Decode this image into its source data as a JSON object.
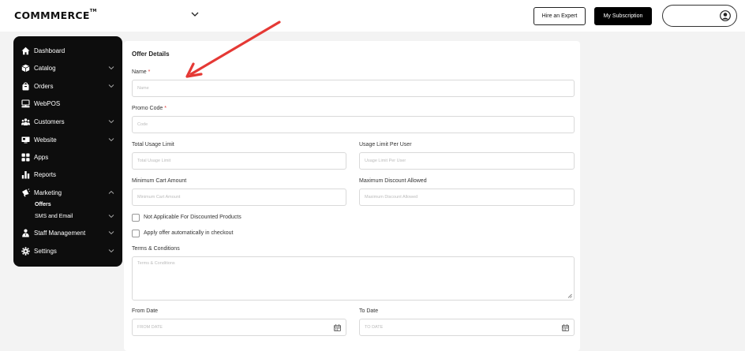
{
  "brand": {
    "logo_text": "COMMMERCE",
    "trademark": "TM"
  },
  "header": {
    "hire_label": "Hire an Expert",
    "subscription_label": "My Subscription"
  },
  "sidebar": {
    "items": [
      {
        "label": "Dashboard",
        "icon": "home-icon",
        "has_chevron": false
      },
      {
        "label": "Catalog",
        "icon": "box-icon",
        "has_chevron": true
      },
      {
        "label": "Orders",
        "icon": "bag-icon",
        "has_chevron": true
      },
      {
        "label": "WebPOS",
        "icon": "pos-icon",
        "has_chevron": false
      },
      {
        "label": "Customers",
        "icon": "users-icon",
        "has_chevron": true
      },
      {
        "label": "Website",
        "icon": "website-icon",
        "has_chevron": true
      },
      {
        "label": "Apps",
        "icon": "apps-icon",
        "has_chevron": false
      },
      {
        "label": "Reports",
        "icon": "chart-icon",
        "has_chevron": false
      },
      {
        "label": "Marketing",
        "icon": "megaphone-icon",
        "has_chevron": true,
        "expanded": true
      },
      {
        "label": "Staff Management",
        "icon": "staff-icon",
        "has_chevron": true
      },
      {
        "label": "Settings",
        "icon": "gear-icon",
        "has_chevron": true
      }
    ],
    "marketing_sub": [
      {
        "label": "Offers",
        "active": true
      },
      {
        "label": "SMS and Email",
        "active": false,
        "has_chevron": true
      }
    ]
  },
  "form": {
    "section_title": "Offer Details",
    "name": {
      "label": "Name",
      "required": "*",
      "placeholder": "Name"
    },
    "promo": {
      "label": "Promo Code",
      "required": "*",
      "placeholder": "Code"
    },
    "total_usage": {
      "label": "Total Usage Limit",
      "placeholder": "Total Usage Limit"
    },
    "per_user": {
      "label": "Usage Limit Per User",
      "placeholder": "Usage Limit Per User"
    },
    "min_cart": {
      "label": "Minimum Cart Amount",
      "placeholder": "Minimum Cart Amount"
    },
    "max_discount": {
      "label": "Maximum Discount Allowed",
      "placeholder": "Maximum Discount Allowed"
    },
    "not_applicable": {
      "label": "Not Applicable For Discounted Products",
      "checked": false
    },
    "auto_apply": {
      "label": "Apply offer automatically in checkout",
      "checked": false
    },
    "terms": {
      "label": "Terms & Conditions",
      "placeholder": "Terms & Conditions"
    },
    "from_date": {
      "label": "From Date",
      "placeholder": "FROM DATE"
    },
    "to_date": {
      "label": "To Date",
      "placeholder": "TO DATE"
    }
  },
  "colors": {
    "accent_red": "#e53935",
    "sidebar_bg": "#0d0d0d",
    "arrow": "#e53935"
  }
}
